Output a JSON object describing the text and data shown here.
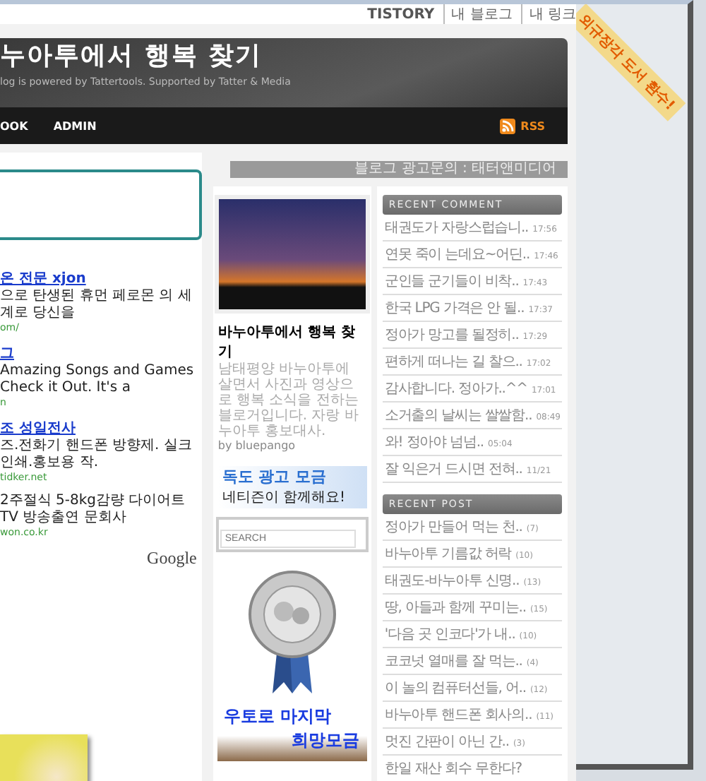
{
  "topbar": {
    "brand": "TISTORY",
    "links": [
      "내 블로그",
      "내 링크"
    ]
  },
  "ribbon": {
    "text": "외규장각 도서 환수!"
  },
  "header": {
    "title": "누아투에서 행복 찾기",
    "subtitle": "log is powered by Tattertools. Supported by Tatter & Media",
    "nav": [
      "OOK",
      "ADMIN"
    ],
    "rss": "RSS"
  },
  "ad_banner": {
    "text": "블로그 광고문의 : 태터앤미디어"
  },
  "ads": [
    {
      "title": "온 전문 xjon",
      "desc": "으로 탄생된 휴먼 페로몬 의 세계로 당신을",
      "url": "om/"
    },
    {
      "title": "그",
      "desc": "Amazing Songs and Games Check it Out. It's a",
      "url": "n"
    },
    {
      "title": "조 성일전사",
      "desc": "즈.전화기 핸드폰 방향제. 실크인쇄.홍보용 작.",
      "url": "tidker.net"
    },
    {
      "desc": "2주절식 5-8kg감량 다이어트 TV 방송출연 문회사",
      "url": "won.co.kr"
    }
  ],
  "ads_by": "Google",
  "profile": {
    "title": "바누아투에서 행복 찾기",
    "desc": "남태평양 바누아투에 살면서 사진과 영상으로 행복 소식을 전하는 블로거입니다. 자랑 바누아투 홍보대사.",
    "by": "by bluepango"
  },
  "dokdo_banner": {
    "title": "독도 광고 모금",
    "subtitle": "네티즌이 함께해요!"
  },
  "search": {
    "placeholder": "SEARCH"
  },
  "utoro_banner": {
    "line1": "우토로 마지막",
    "line2": "희망모금"
  },
  "recent_comment": {
    "heading": "RECENT COMMENT",
    "items": [
      {
        "text": "태권도가 자랑스럽습니..",
        "time": "17:56"
      },
      {
        "text": "연못 죽이 는데요~어딘..",
        "time": "17:46"
      },
      {
        "text": "군인들 군기들이 비착..",
        "time": "17:43"
      },
      {
        "text": "한국 LPG 가격은 안 될..",
        "time": "17:37"
      },
      {
        "text": "정아가 망고를 될정히..",
        "time": "17:29"
      },
      {
        "text": "편하게 떠나는 길 찰으..",
        "time": "17:02"
      },
      {
        "text": "감사합니다. 정아가..^^",
        "time": "17:01"
      },
      {
        "text": "소거출의 날씨는 쌀쌀함..",
        "time": "08:49"
      },
      {
        "text": "와! 정아야 넘넘..",
        "time": "05:04"
      },
      {
        "text": "잘 익은거 드시면 전혀..",
        "time": "11/21"
      }
    ]
  },
  "recent_post": {
    "heading": "RECENT POST",
    "items": [
      {
        "text": "정아가 만들어 먹는 천..",
        "count": "(7)"
      },
      {
        "text": "바누아투 기름값 허락",
        "count": "(10)"
      },
      {
        "text": "태권도-바누아투 신명..",
        "count": "(13)"
      },
      {
        "text": "땅, 아들과 함께 꾸미는..",
        "count": "(15)"
      },
      {
        "text": "'다음 곳 인코다'가 내..",
        "count": "(10)"
      },
      {
        "text": "코코넛 열매를 잘 먹는..",
        "count": "(4)"
      },
      {
        "text": "이 놀의 컴퓨터선들, 어..",
        "count": "(12)"
      },
      {
        "text": "바누아투 핸드폰 회사의..",
        "count": "(11)"
      },
      {
        "text": "멋진 간판이 아닌 간..",
        "count": "(3)"
      },
      {
        "text": "한일 재산 회수 무한다?"
      }
    ]
  }
}
